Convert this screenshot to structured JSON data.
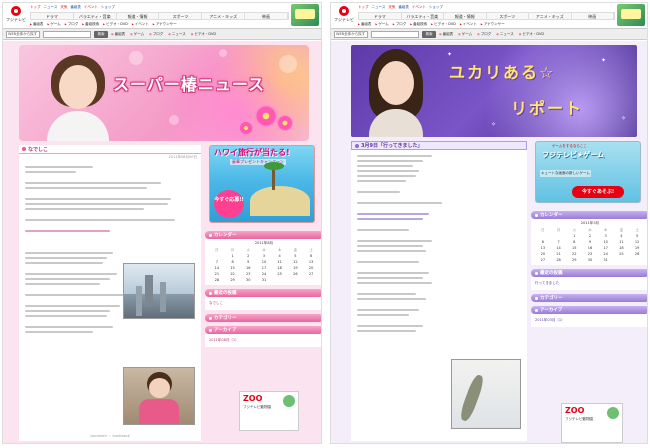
{
  "portal": {
    "logo_text": "フジテレビ",
    "top_links": [
      "トップ",
      "ニュース",
      "天気",
      "番組表",
      "イベント",
      "ショップ",
      "メディア",
      "BBS"
    ],
    "nav_tabs": [
      "ドラマ",
      "バラエティ・音楽",
      "報道・情報",
      "スポーツ",
      "アニメ・キッズ",
      "映画",
      "ニュース"
    ],
    "sub_links": [
      "番組表",
      "ゲーム",
      "ブログ",
      "番組検索",
      "ビデオ・DVD",
      "イベント",
      "アナウンサー",
      "ニュース"
    ],
    "search_select": "WEB全体から探す",
    "search_button": "検索",
    "quick_links": [
      "番組表",
      "ゲーム",
      "ブログ",
      "ニュース",
      "ビデオ・DVD",
      "イベント",
      "アナウンサー"
    ]
  },
  "left": {
    "banner_title": "スーパー椿ニュース",
    "post_title": "なでしこ",
    "post_date": "2011年08月00日",
    "promo_headline": "ハワイ旅行が当たる!",
    "promo_sub": "豪華プレゼントキャンペーン",
    "promo_button": "今すぐ応募!!",
    "sidebar": {
      "calendar_head": "カレンダー",
      "calendar_month": "2011年8月",
      "dow": [
        "日",
        "月",
        "火",
        "水",
        "木",
        "金",
        "土"
      ],
      "weeks": [
        [
          "",
          "1",
          "2",
          "3",
          "4",
          "5",
          "6"
        ],
        [
          "7",
          "8",
          "9",
          "10",
          "11",
          "12",
          "13"
        ],
        [
          "14",
          "15",
          "16",
          "17",
          "18",
          "19",
          "20"
        ],
        [
          "21",
          "22",
          "23",
          "24",
          "25",
          "26",
          "27"
        ],
        [
          "28",
          "29",
          "30",
          "31",
          "",
          "",
          ""
        ]
      ],
      "recent_head": "最近の投稿",
      "recent_item": "なでしこ",
      "category_head": "カテゴリー",
      "archive_head": "アーカイブ",
      "archive_item": "2011年08月（1）"
    },
    "zoo_logo": "ZOO",
    "zoo_text": "フジテレビ動物園"
  },
  "right": {
    "banner_title_1": "ユカリある☆",
    "banner_title_2": "リポート",
    "post_title": "3月9日「行ってきました」",
    "promo_small": "ゲームをするならここ",
    "promo_title": "フジテレビ★ゲーム",
    "promo_desc": "キュートな画面の新しいゲーム",
    "promo_button": "今すぐあそぶ!",
    "sidebar": {
      "calendar_head": "カレンダー",
      "calendar_month": "2011年3月",
      "dow": [
        "日",
        "月",
        "火",
        "水",
        "木",
        "金",
        "土"
      ],
      "weeks": [
        [
          "",
          "",
          "1",
          "2",
          "3",
          "4",
          "5"
        ],
        [
          "6",
          "7",
          "8",
          "9",
          "10",
          "11",
          "12"
        ],
        [
          "13",
          "14",
          "15",
          "16",
          "17",
          "18",
          "19"
        ],
        [
          "20",
          "21",
          "22",
          "23",
          "24",
          "25",
          "26"
        ],
        [
          "27",
          "28",
          "29",
          "30",
          "31",
          "",
          ""
        ]
      ],
      "recent_head": "最近の投稿",
      "recent_item": "行ってきました",
      "category_head": "カテゴリー",
      "archive_head": "アーカイブ",
      "archive_item": "2011年03月（1）"
    },
    "zoo_logo": "ZOO",
    "zoo_text": "フジテレビ動物園"
  },
  "colors": {
    "left_accent": "#e9659c",
    "right_accent": "#9a7ad9",
    "brand_red": "#e60012"
  }
}
